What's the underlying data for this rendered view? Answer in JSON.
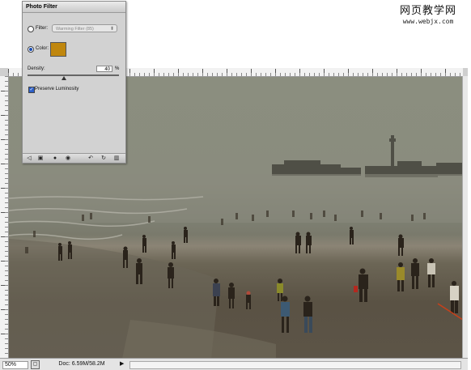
{
  "watermark": {
    "cn": "网页教学网",
    "url": "www.webjx.com"
  },
  "photo_filter": {
    "title": "Photo Filter",
    "filter_label": "Filter:",
    "filter_value": "Warming Filter (85)",
    "color_label": "Color:",
    "color_hex": "#c0870e",
    "density_label": "Density:",
    "density_value": "40",
    "density_unit": "%",
    "density_level": 0.4,
    "preserve_label": "Preserve Luminosity",
    "preserve_checked": true,
    "selected_option": "color"
  },
  "status": {
    "zoom": "50%",
    "doc_info": "Doc: 6.59M/58.2M",
    "arrow": "▶"
  },
  "colors": {
    "sand": "#5b5345",
    "haze": "#8a8c7e"
  }
}
